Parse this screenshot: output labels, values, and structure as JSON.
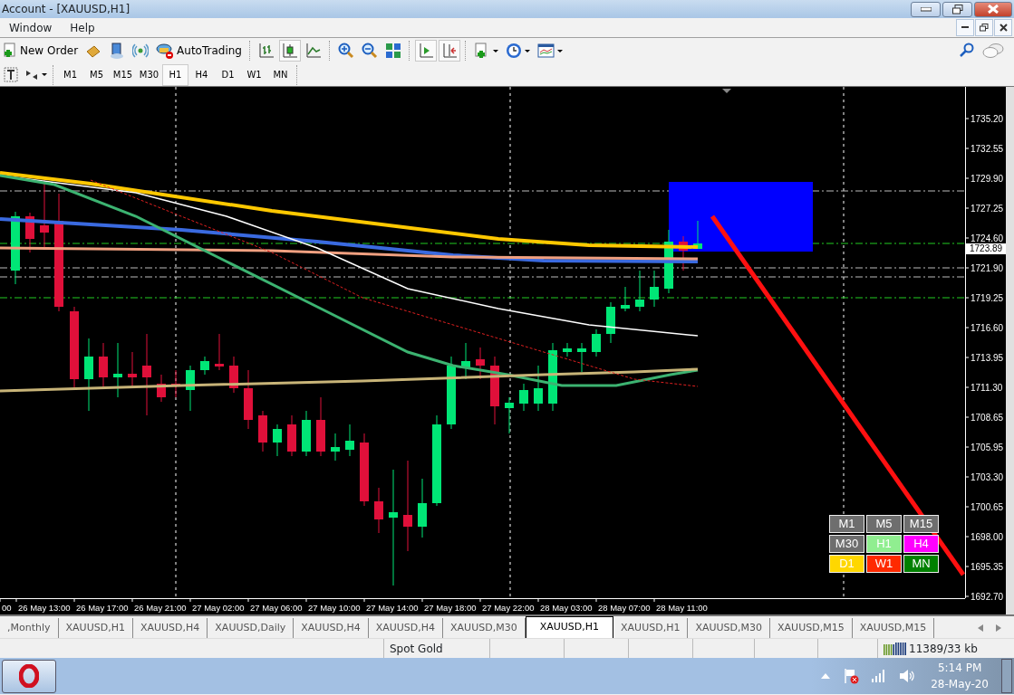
{
  "window": {
    "title": "Account - [XAUUSD,H1]"
  },
  "menu": [
    {
      "label": "Window"
    },
    {
      "label": "Help"
    }
  ],
  "toolbar": {
    "new_order": "New Order",
    "auto_trading": "AutoTrading",
    "chart_modes": [
      {
        "kind": "bars",
        "selected": false
      },
      {
        "kind": "candles",
        "selected": true
      },
      {
        "kind": "line",
        "selected": false
      }
    ],
    "scroll_modes": [
      {
        "kind": "autoscroll",
        "selected": true
      },
      {
        "kind": "shift",
        "selected": true
      }
    ]
  },
  "timeframes": [
    {
      "label": "M1",
      "selected": false
    },
    {
      "label": "M5",
      "selected": false
    },
    {
      "label": "M15",
      "selected": false
    },
    {
      "label": "M30",
      "selected": false
    },
    {
      "label": "H1",
      "selected": true
    },
    {
      "label": "H4",
      "selected": false
    },
    {
      "label": "D1",
      "selected": false
    },
    {
      "label": "W1",
      "selected": false
    },
    {
      "label": "MN",
      "selected": false
    }
  ],
  "chart": {
    "price_labels": [
      "1735.20",
      "1732.55",
      "1729.90",
      "1727.25",
      "1724.60",
      "1721.90",
      "1719.25",
      "1716.60",
      "1713.95",
      "1711.30",
      "1708.65",
      "1705.95",
      "1703.30",
      "1700.65",
      "1698.00",
      "1695.35",
      "1692.70"
    ],
    "current_price": "1723.89",
    "time_labels": [
      "00",
      "26 May 13:00",
      "26 May 17:00",
      "26 May 21:00",
      "27 May 02:00",
      "27 May 06:00",
      "27 May 10:00",
      "27 May 14:00",
      "27 May 18:00",
      "27 May 22:00",
      "28 May 03:00",
      "28 May 07:00",
      "28 May 11:00"
    ],
    "period_panel": [
      {
        "label": "M1",
        "color": "#6e6e6e"
      },
      {
        "label": "M5",
        "color": "#6e6e6e"
      },
      {
        "label": "M15",
        "color": "#6e6e6e"
      },
      {
        "label": "M30",
        "color": "#6e6e6e"
      },
      {
        "label": "H1",
        "color": "#90ee90"
      },
      {
        "label": "H4",
        "color": "#ff00ff"
      },
      {
        "label": "D1",
        "color": "#ffd700"
      },
      {
        "label": "W1",
        "color": "#ff2a00"
      },
      {
        "label": "MN",
        "color": "#008000"
      }
    ]
  },
  "chart_tabs": [
    {
      "label": ",Monthly",
      "selected": false
    },
    {
      "label": "XAUUSD,H1",
      "selected": false
    },
    {
      "label": "XAUUSD,H4",
      "selected": false
    },
    {
      "label": "XAUUSD,Daily",
      "selected": false
    },
    {
      "label": "XAUUSD,H4",
      "selected": false
    },
    {
      "label": "XAUUSD,H4",
      "selected": false
    },
    {
      "label": "XAUUSD,M30",
      "selected": false
    },
    {
      "label": "XAUUSD,H1",
      "selected": true
    },
    {
      "label": "XAUUSD,H1",
      "selected": false
    },
    {
      "label": "XAUUSD,M30",
      "selected": false
    },
    {
      "label": "XAUUSD,M15",
      "selected": false
    },
    {
      "label": "XAUUSD,M15",
      "selected": false
    }
  ],
  "status_bar": {
    "profile": "Spot Gold",
    "traffic": "11389/33 kb"
  },
  "taskbar": {
    "time": "5:14 PM",
    "date": "28-May-20"
  }
}
